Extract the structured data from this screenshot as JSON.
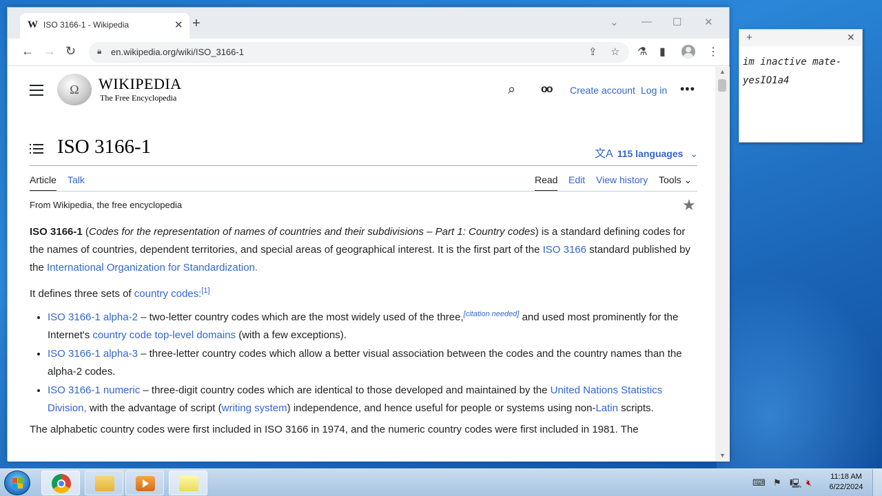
{
  "browser": {
    "tab_title": "ISO 3166-1 - Wikipedia",
    "favicon": "W",
    "url": "en.wikipedia.org/wiki/ISO_3166-1"
  },
  "wiki": {
    "wordmark": "WIKIPEDIA",
    "tagline": "The Free Encyclopedia",
    "create_account": "Create account",
    "log_in": "Log in",
    "title": "ISO 3166-1",
    "languages": "115 languages",
    "tabs": {
      "article": "Article",
      "talk": "Talk",
      "read": "Read",
      "edit": "Edit",
      "view_history": "View history",
      "tools": "Tools"
    },
    "from": "From Wikipedia, the free encyclopedia",
    "para1": {
      "bold": "ISO 3166-1",
      "open": " (",
      "italic": "Codes for the representation of names of countries and their subdivisions – Part 1: Country codes",
      "text1": ") is a standard defining codes for the names of countries, dependent territories, and special areas of geographical interest. It is the first part of the ",
      "link1": "ISO 3166",
      "text2": " standard published by the ",
      "link2": "International Organization for Standardization."
    },
    "para2": {
      "text": "It defines three sets of ",
      "link": "country codes:",
      "ref": "[1]"
    },
    "bullets": [
      {
        "link": "ISO 3166-1 alpha-2",
        "text1": " – two-letter country codes which are the most widely used of the three,",
        "cite": "[citation needed]",
        "text2": " and used most prominently for the Internet's ",
        "link2": "country code top-level domains",
        "text3": " (with a few exceptions)."
      },
      {
        "link": "ISO 3166-1 alpha-3",
        "text1": " – three-letter country codes which allow a better visual association between the codes and the country names than the alpha-2 codes."
      },
      {
        "link": "ISO 3166-1 numeric",
        "text1": " – three-digit country codes which are identical to those developed and maintained by the ",
        "link2": "United Nations Statistics Division,",
        "text2": " with the advantage of script (",
        "link3": "writing system",
        "text3": ") independence, and hence useful for people or systems using non-",
        "link4": "Latin",
        "text4": " scripts."
      }
    ],
    "para3": "The alphabetic country codes were first included in ISO 3166 in 1974, and the numeric country codes were first included in 1981. The"
  },
  "note": {
    "text": "im inactive mate-\nyesIO1a4"
  },
  "taskbar": {
    "time": "11:18 AM",
    "date": "6/22/2024"
  },
  "icons": [
    "w-favicon-icon",
    "close-icon",
    "plus-icon",
    "chevron-down-icon",
    "minimize-icon",
    "maximize-icon",
    "back-icon",
    "forward-icon",
    "reload-icon",
    "lock-icon",
    "share-icon",
    "bookmark-star-icon",
    "extension-icon",
    "sidebar-icon",
    "profile-icon",
    "menu-dots-icon",
    "hamburger-icon",
    "wikipedia-globe-icon",
    "search-icon",
    "watch-eyes-icon",
    "more-icon",
    "toc-icon",
    "translate-icon",
    "star-icon",
    "windows-start-icon",
    "chrome-icon",
    "folder-icon",
    "media-player-icon",
    "sticky-notes-icon"
  ]
}
